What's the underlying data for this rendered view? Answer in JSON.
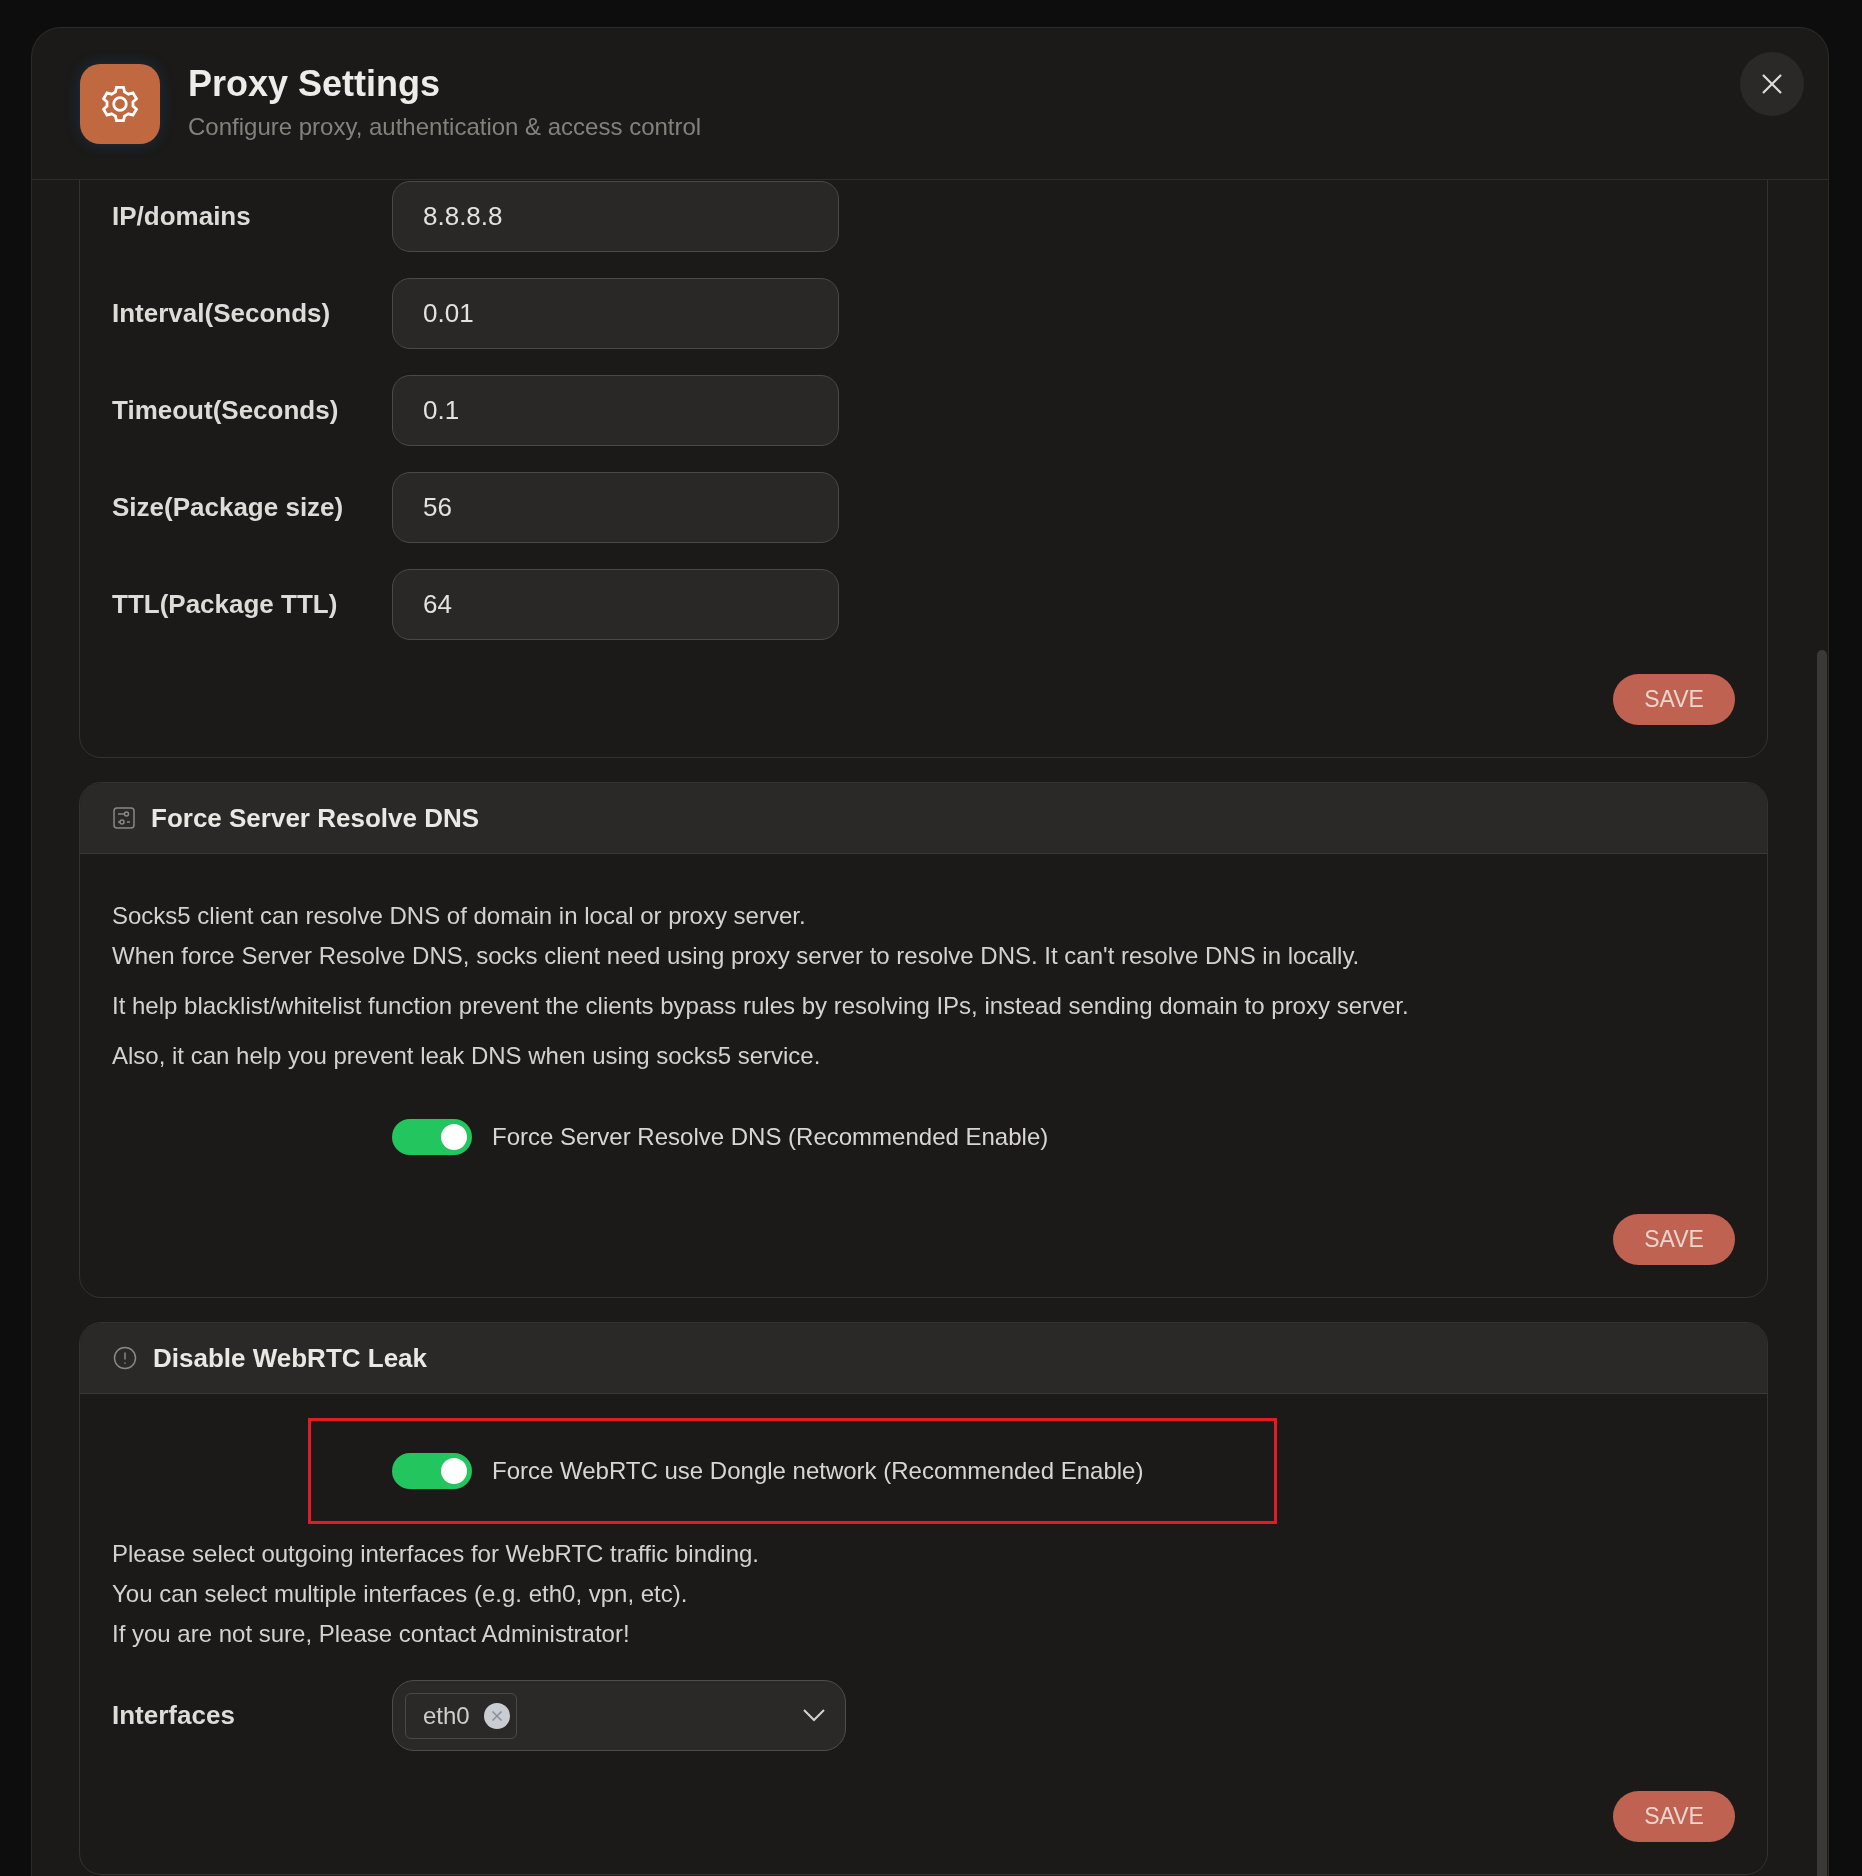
{
  "dialog": {
    "title": "Proxy Settings",
    "subtitle": "Configure proxy, authentication & access control"
  },
  "ping_section": {
    "fields": [
      {
        "label": "IP/domains",
        "value": "8.8.8.8"
      },
      {
        "label": "Interval(Seconds)",
        "value": "0.01"
      },
      {
        "label": "Timeout(Seconds)",
        "value": "0.1"
      },
      {
        "label": "Size(Package size)",
        "value": "56"
      },
      {
        "label": "TTL(Package TTL)",
        "value": "64"
      }
    ],
    "save_button": "SAVE"
  },
  "dns_section": {
    "title": "Force Server Resolve DNS",
    "paragraphs": [
      "Socks5 client can resolve DNS of domain in local or proxy server.\nWhen force Server Resolve DNS, socks client need using proxy server to resolve DNS. It can't resolve DNS in locally.",
      "It help blacklist/whitelist function prevent the clients bypass rules by resolving IPs, instead sending domain to proxy server.",
      "Also, it can help you prevent leak DNS when using socks5 service."
    ],
    "toggle": {
      "label": "Force Server Resolve DNS (Recommended Enable)",
      "on": true,
      "highlighted": false
    },
    "save_button": "SAVE"
  },
  "webrtc_section": {
    "title": "Disable WebRTC Leak",
    "toggle": {
      "label": "Force WebRTC use Dongle network (Recommended Enable)",
      "on": true,
      "highlighted": true
    },
    "paragraphs": [
      "Please select outgoing interfaces for WebRTC traffic binding.",
      "You can select multiple interfaces (e.g. eth0, vpn, etc).",
      "If you are not sure, Please contact Administrator!"
    ],
    "interfaces": {
      "label": "Interfaces",
      "selected_tags": [
        "eth0"
      ]
    },
    "save_button": "SAVE"
  }
}
